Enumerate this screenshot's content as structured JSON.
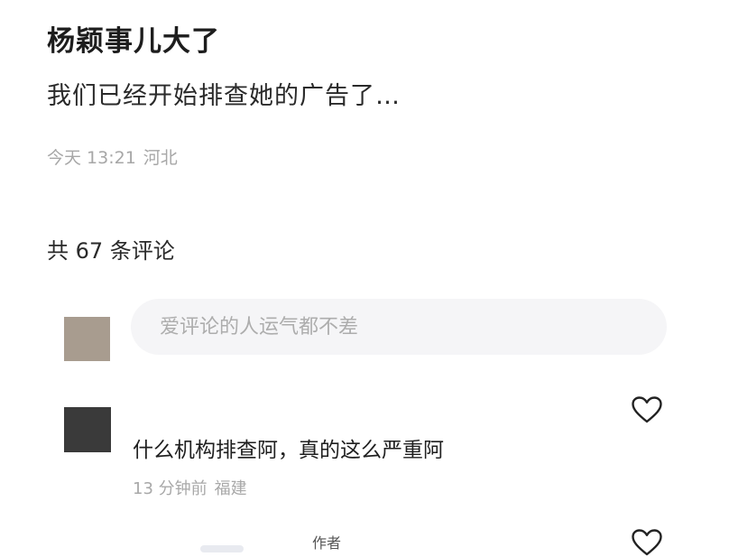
{
  "post": {
    "title": "杨颖事儿大了",
    "body": "我们已经开始排查她的广告了…",
    "time": "今天 13:21",
    "location": "河北"
  },
  "comments_header": {
    "count_label": "共 67 条评论"
  },
  "composer": {
    "placeholder": "爱评论的人运气都不差"
  },
  "comments": [
    {
      "text": "什么机构排查阿，真的这么严重阿",
      "time": "13 分钟前",
      "location": "福建"
    },
    {
      "author_tag": "作者"
    }
  ],
  "icons": {
    "like": "heart-outline-icon"
  },
  "colors": {
    "my_avatar": "#a89c8f",
    "commenter_avatar": "#3a3a3a",
    "input_bg": "#f5f5f7",
    "meta_text": "#a8a8a8"
  }
}
